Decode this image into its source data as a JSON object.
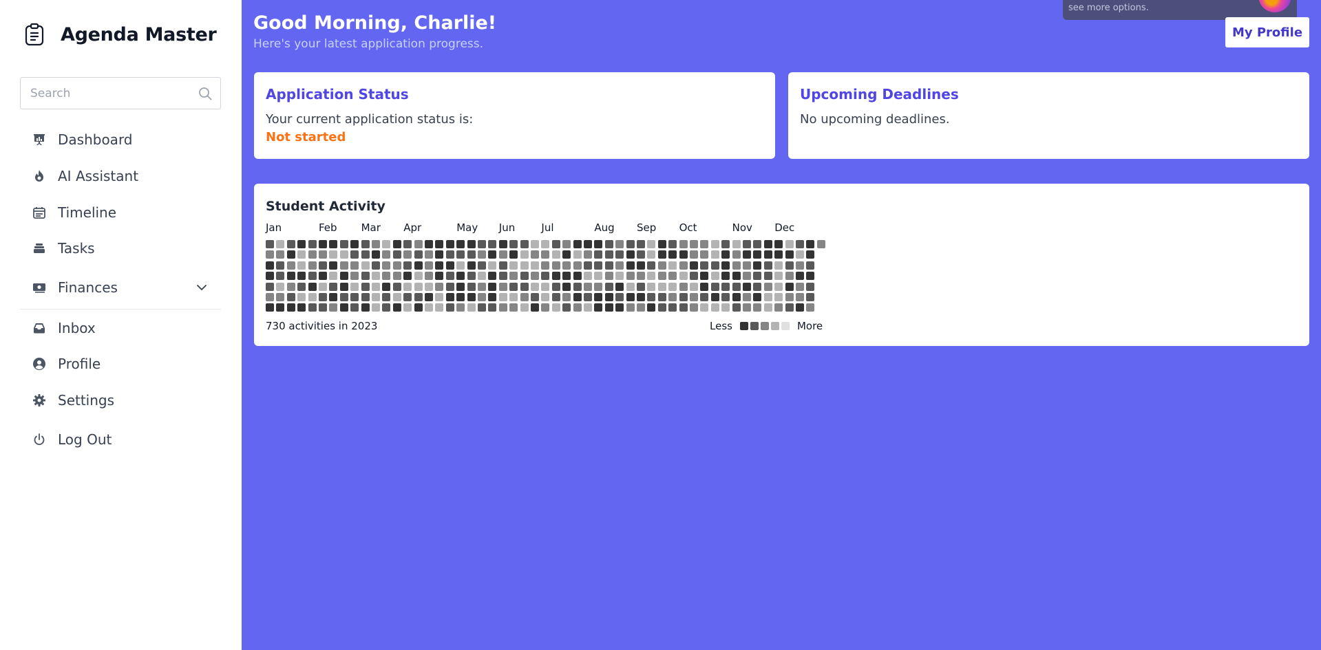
{
  "app": {
    "title": "Agenda Master",
    "logo_icon": "clipboard-list-icon"
  },
  "search": {
    "placeholder": "Search"
  },
  "sidebar": {
    "items": [
      {
        "label": "Dashboard",
        "icon": "presentation-chart-icon"
      },
      {
        "label": "AI Assistant",
        "icon": "fire-icon"
      },
      {
        "label": "Timeline",
        "icon": "calendar-icon"
      },
      {
        "label": "Tasks",
        "icon": "layers-stack-icon"
      },
      {
        "label": "Finances",
        "icon": "money-bill-icon",
        "expandable": true
      },
      {
        "label": "Inbox",
        "icon": "inbox-tray-icon"
      },
      {
        "label": "Profile",
        "icon": "user-circle-icon"
      },
      {
        "label": "Settings",
        "icon": "gear-icon"
      },
      {
        "label": "Log Out",
        "icon": "power-icon"
      }
    ]
  },
  "header": {
    "greeting": "Good Morning, Charlie!",
    "subtitle": "Here's your latest application progress.",
    "profile_button": "My Profile"
  },
  "toast": {
    "text": "see more options."
  },
  "application_status": {
    "title": "Application Status",
    "text": "Your current application status is:",
    "value": "Not started"
  },
  "deadlines": {
    "title": "Upcoming Deadlines",
    "text": "No upcoming deadlines."
  },
  "activity": {
    "title": "Student Activity",
    "months": [
      "Jan",
      "Feb",
      "Mar",
      "Apr",
      "May",
      "Jun",
      "Jul",
      "Aug",
      "Sep",
      "Oct",
      "Nov",
      "Dec"
    ],
    "summary": "730 activities in 2023",
    "legend_less": "Less",
    "legend_more": "More",
    "weeks": 53,
    "days_per_week": 7,
    "first_week_days": 1,
    "level_colors": [
      "#333333",
      "#595959",
      "#858585",
      "#b3b3b3",
      "#e0e0e0"
    ]
  },
  "colors": {
    "accent": "#6366f1",
    "title_accent": "#4f46e5",
    "status_orange": "#f97316"
  }
}
